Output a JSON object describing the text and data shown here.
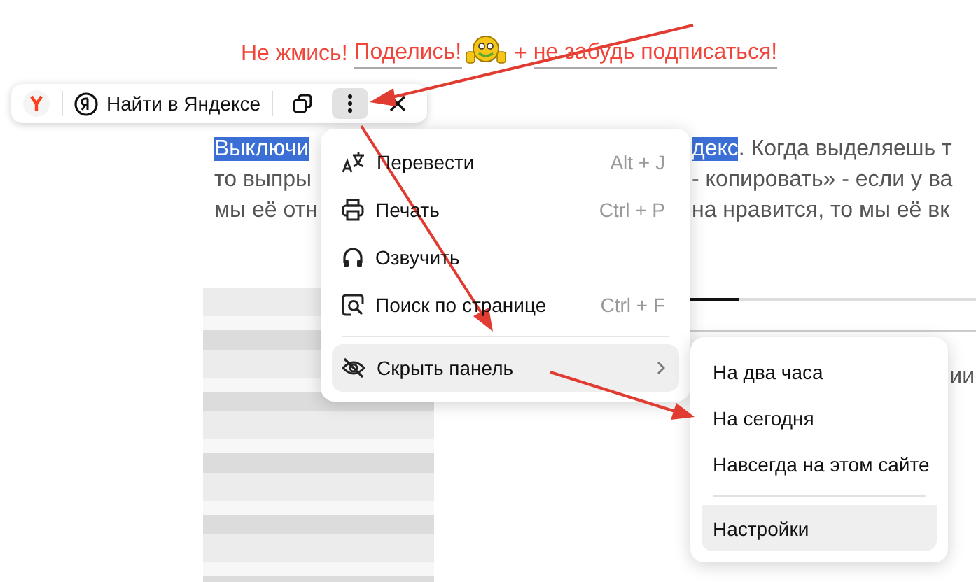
{
  "banner": {
    "segments": [
      {
        "kind": "text",
        "text": "Не жмись! "
      },
      {
        "kind": "link",
        "text": "Поделись!"
      },
      {
        "kind": "emoji"
      },
      {
        "kind": "text",
        "text": " + "
      },
      {
        "kind": "link",
        "text": "не забудь подписаться!"
      }
    ]
  },
  "toolbar": {
    "search_label": "Найти в Яндексе",
    "buttons": [
      {
        "kind": "copy",
        "selected": false
      },
      {
        "kind": "more",
        "selected": true
      },
      {
        "kind": "close",
        "selected": false
      }
    ]
  },
  "paragraph": {
    "lines": [
      {
        "left": [
          {
            "text": "Выключи",
            "highlighted": true
          }
        ],
        "right": [
          {
            "text": "декс",
            "highlighted": true
          },
          {
            "text": ". Когда выделяешь т",
            "highlighted": false
          }
        ]
      },
      {
        "left": [
          {
            "text": "то выпры",
            "highlighted": false
          }
        ],
        "right": [
          {
            "text": "- копировать» - если у ва",
            "highlighted": false
          }
        ]
      },
      {
        "left": [
          {
            "text": "мы её отн",
            "highlighted": false
          }
        ],
        "right": [
          {
            "text": "на нравится, то мы её вк",
            "highlighted": false
          }
        ]
      }
    ]
  },
  "side_text": "ии",
  "menu": {
    "items": [
      {
        "kind": "translate",
        "label": "Перевести",
        "shortcut": "Alt + J",
        "submenu": false,
        "separator_before": false,
        "selected": false
      },
      {
        "kind": "print",
        "label": "Печать",
        "shortcut": "Ctrl + P",
        "submenu": false,
        "separator_before": false,
        "selected": false
      },
      {
        "kind": "listen",
        "label": "Озвучить",
        "submenu": false,
        "separator_before": false,
        "selected": false
      },
      {
        "kind": "find",
        "label": "Поиск по странице",
        "shortcut": "Ctrl + F",
        "submenu": false,
        "separator_before": false,
        "selected": false
      },
      {
        "kind": "hide",
        "label": "Скрыть панель",
        "submenu": true,
        "separator_before": true,
        "selected": true
      }
    ]
  },
  "submenu": {
    "items": [
      {
        "label": "На два часа",
        "separator_before": false,
        "selected": false
      },
      {
        "label": "На сегодня",
        "separator_before": false,
        "selected": false
      },
      {
        "label": "Навсегда на этом сайте",
        "separator_before": false,
        "selected": false
      },
      {
        "label": "Настройки",
        "separator_before": true,
        "selected": true
      }
    ]
  }
}
